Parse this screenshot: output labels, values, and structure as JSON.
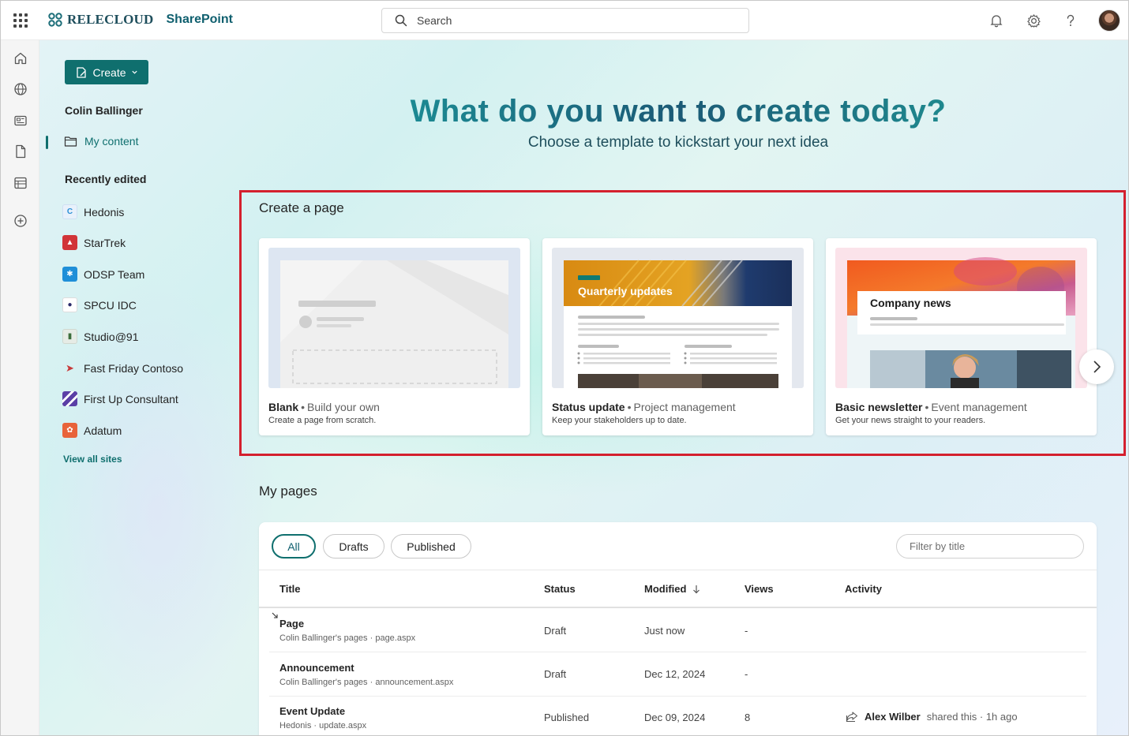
{
  "header": {
    "org_name": "RELECLOUD",
    "app_name": "SharePoint",
    "search_placeholder": "Search"
  },
  "colors": {
    "accent": "#0f6f6e",
    "highlight_border": "#d4202e",
    "brand_text": "#1e4e5c"
  },
  "rail": {
    "icons": [
      "home-icon",
      "globe-icon",
      "news-icon",
      "document-icon",
      "list-icon",
      "add-icon"
    ]
  },
  "nav": {
    "create_label": "Create",
    "user_name": "Colin Ballinger",
    "my_content": "My content",
    "recently_edited": "Recently edited",
    "sites": [
      {
        "label": "Hedonis",
        "color": "#2a8fd6"
      },
      {
        "label": "StarTrek",
        "color": "#d13438"
      },
      {
        "label": "ODSP Team",
        "color": "#1f8fd8"
      },
      {
        "label": "SPCU IDC",
        "color": "#2b2b6a"
      },
      {
        "label": "Studio@91",
        "color": "#3c6e3c"
      },
      {
        "label": "Fast Friday Contoso",
        "color": "#c73a3a"
      },
      {
        "label": "First Up Consultant",
        "color": "#5b3fa6"
      },
      {
        "label": "Adatum",
        "color": "#e8633a"
      }
    ],
    "view_all": "View all sites"
  },
  "hero": {
    "title": "What do you want to create today?",
    "subtitle": "Choose a template to kickstart your next idea"
  },
  "create_page": {
    "title": "Create a page",
    "templates": [
      {
        "name": "Blank",
        "category": "Build your own",
        "description": "Create a page from scratch."
      },
      {
        "name": "Status update",
        "category": "Project management",
        "description": "Keep your stakeholders up to date.",
        "thumb_text": "Quarterly updates"
      },
      {
        "name": "Basic newsletter",
        "category": "Event management",
        "description": "Get your news straight to your readers.",
        "thumb_text": "Company news"
      }
    ]
  },
  "my_pages": {
    "title": "My pages",
    "filters": [
      "All",
      "Drafts",
      "Published"
    ],
    "active_filter": "All",
    "filter_placeholder": "Filter by title",
    "columns": {
      "title": "Title",
      "status": "Status",
      "modified": "Modified",
      "views": "Views",
      "activity": "Activity"
    },
    "rows": [
      {
        "title": "Page",
        "location": "Colin Ballinger's pages · page.aspx",
        "status": "Draft",
        "modified": "Just now",
        "views": "-"
      },
      {
        "title": "Announcement",
        "location": "Colin Ballinger's pages · announcement.aspx",
        "status": "Draft",
        "modified": "Dec 12, 2024",
        "views": "-"
      },
      {
        "title": "Event Update",
        "location": "Hedonis · update.aspx",
        "status": "Published",
        "modified": "Dec 09, 2024",
        "views": "8",
        "activity_user": "Alex Wilber",
        "activity_text": "shared this · 1h ago"
      }
    ]
  }
}
